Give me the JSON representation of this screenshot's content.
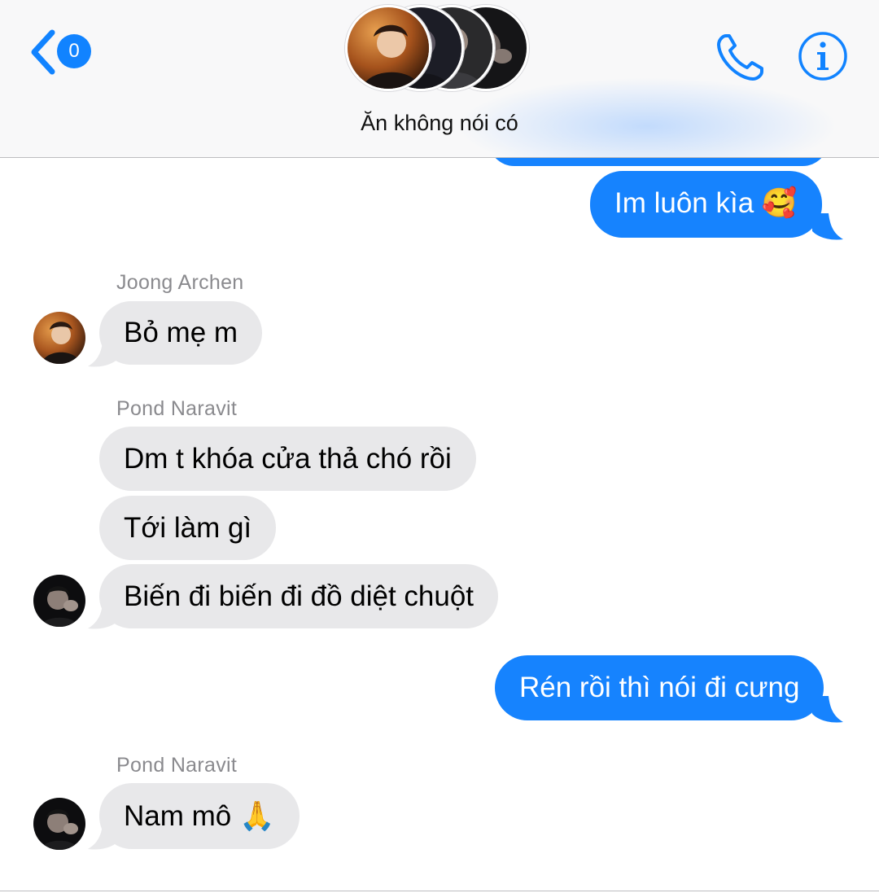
{
  "header": {
    "back_badge_count": "0",
    "conversation_title": "Ăn không nói có",
    "avatars": [
      "avatar-joong",
      "avatar-2",
      "avatar-3",
      "avatar-pond"
    ],
    "icons": {
      "back": "chevron-left-icon",
      "call": "phone-icon",
      "info": "info-icon"
    }
  },
  "colors": {
    "accent": "#1183ff",
    "outgoing_bubble": "#1683fe",
    "incoming_bubble": "#e8e8ea",
    "sender_label": "#8a8a8e"
  },
  "messages": [
    {
      "direction": "outgoing",
      "text": "Im luôn kìa 🥰"
    },
    {
      "direction": "incoming",
      "sender": "Joong Archen",
      "text": "Bỏ mẹ m"
    },
    {
      "direction": "incoming",
      "sender": "Pond Naravit",
      "text": "Dm t khóa cửa thả chó rồi"
    },
    {
      "direction": "incoming",
      "sender": "Pond Naravit",
      "text": "Tới làm gì"
    },
    {
      "direction": "incoming",
      "sender": "Pond Naravit",
      "text": "Biến đi biến đi đồ diệt chuột"
    },
    {
      "direction": "outgoing",
      "text": "Rén rồi thì nói đi cưng"
    },
    {
      "direction": "incoming",
      "sender": "Pond Naravit",
      "text": "Nam mô 🙏"
    }
  ],
  "sender_labels": [
    "Joong Archen",
    "Pond Naravit",
    "Pond Naravit"
  ]
}
